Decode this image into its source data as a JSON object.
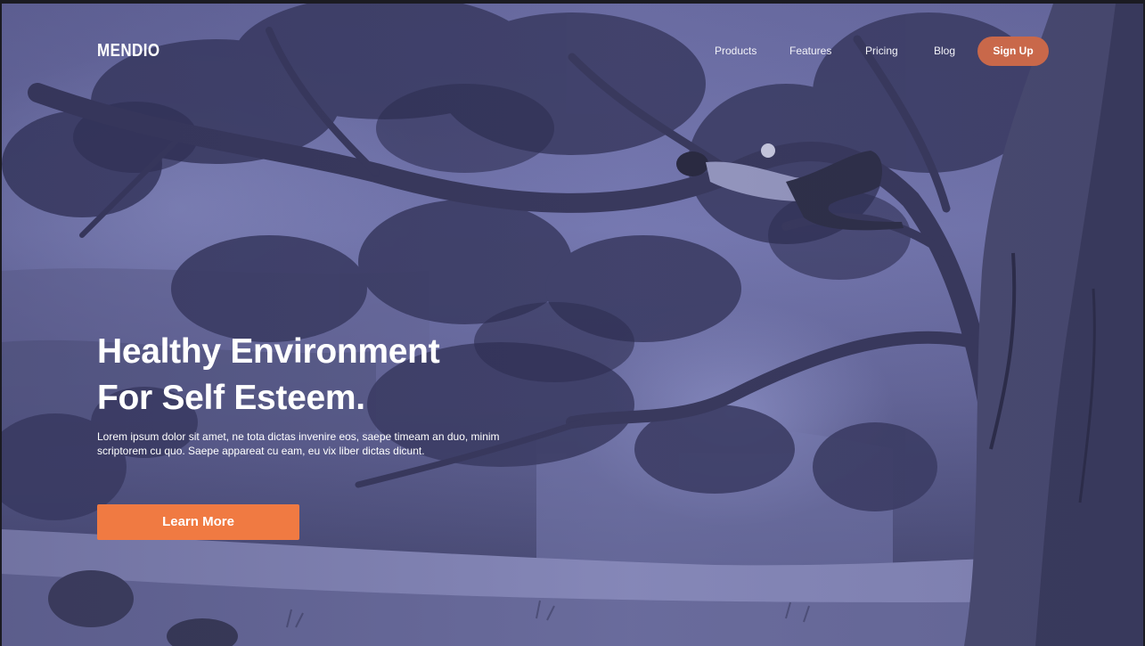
{
  "nav": {
    "logo": "MENDIO",
    "links": [
      "Products",
      "Features",
      "Pricing",
      "Blog"
    ],
    "signup_label": "Sign Up"
  },
  "hero": {
    "headline_line1": "Healthy Environment",
    "headline_line2": "For Self Esteem.",
    "paragraph": "Lorem ipsum dolor sit amet, ne tota dictas invenire eos, saepe timeam an duo, minim scriptorem cu quo. Saepe appareat cu eam, eu vix liber dictas dicunt.",
    "cta_label": "Learn More"
  },
  "colors": {
    "accent": "#f07a42",
    "signup": "#c9684a",
    "tint": "#7a7db6"
  }
}
